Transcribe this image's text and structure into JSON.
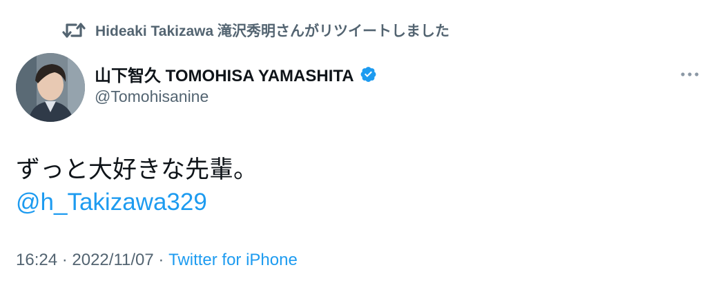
{
  "retweet": {
    "icon": "retweet-icon",
    "text": "Hideaki Takizawa 滝沢秀明さんがリツイートしました"
  },
  "author": {
    "avatar_icon": "user-avatar",
    "display_name": "山下智久 TOMOHISA YAMASHITA",
    "verified_icon": "verified-badge-icon",
    "handle": "@Tomohisanine"
  },
  "more_icon": "more-options-icon",
  "tweet": {
    "text": "ずっと大好きな先輩。",
    "mention": "@h_Takizawa329"
  },
  "meta": {
    "time": "16:24",
    "separator1": " · ",
    "date": "2022/11/07",
    "separator2": " · ",
    "source": "Twitter for iPhone"
  },
  "colors": {
    "text_primary": "#0f1419",
    "text_secondary": "#536471",
    "accent": "#1d9bf0"
  }
}
